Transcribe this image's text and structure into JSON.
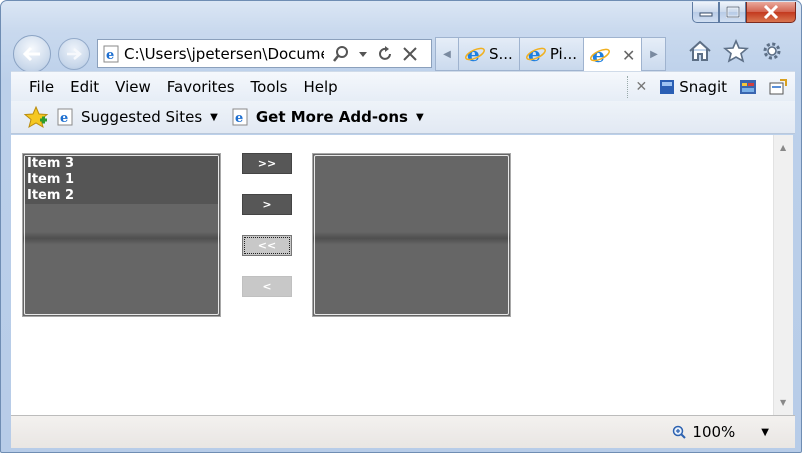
{
  "window": {
    "caption_buttons": [
      "minimize",
      "maximize",
      "close"
    ]
  },
  "address_bar": {
    "url": "C:\\Users\\jpetersen\\Document"
  },
  "tabs": [
    {
      "label": "S..."
    },
    {
      "label": "Pi..."
    },
    {
      "label": ""
    }
  ],
  "menu": {
    "items": [
      "File",
      "Edit",
      "View",
      "Favorites",
      "Tools",
      "Help"
    ],
    "snagit_label": "Snagit"
  },
  "favorites_bar": {
    "suggested_sites": "Suggested Sites",
    "get_addons": "Get More Add-ons"
  },
  "page": {
    "left_list": {
      "items": [
        "Item 3",
        "Item 1",
        "Item 2"
      ]
    },
    "right_list": {
      "items": []
    },
    "buttons": {
      "move_all_right": ">>",
      "move_right": ">",
      "move_all_left": "<<",
      "move_left": "<"
    }
  },
  "status_bar": {
    "zoom": "100%"
  },
  "colors": {
    "list_background": "#666666",
    "button_dark": "#575757",
    "button_disabled": "#c8c8c8"
  }
}
